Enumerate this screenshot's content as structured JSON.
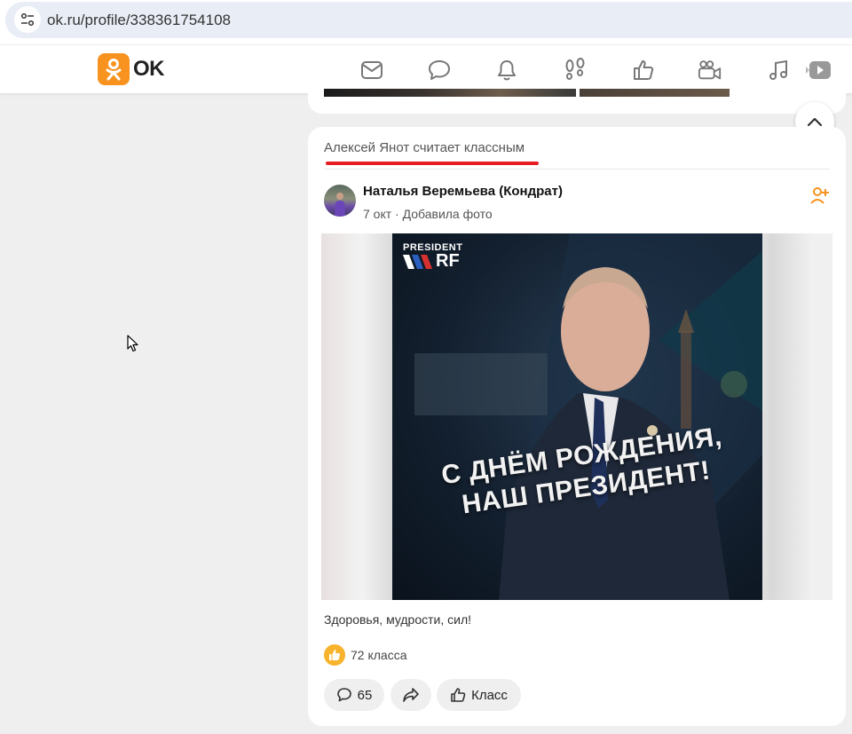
{
  "browser": {
    "url": "ok.ru/profile/338361754108",
    "site_info_icon": "tune-icon"
  },
  "header": {
    "logo_text": "OK",
    "brand_color": "#f7931e",
    "nav_icons": [
      "mail-icon",
      "chat-icon",
      "bell-icon",
      "footprints-icon",
      "thumbs-up-icon",
      "video-icon",
      "music-icon",
      "play-icon"
    ]
  },
  "feed": {
    "card_header": "Алексей Янот считает классным",
    "accent_color": "#e61e24",
    "post": {
      "author": "Наталья Веремьева (Кондрат)",
      "meta": "7 окт · Добавила фото",
      "image": {
        "brand_top": "PRESIDENT",
        "brand_bottom": "RF",
        "headline_line1": "С ДНЁМ РОЖДЕНИЯ,",
        "headline_line2": "НАШ ПРЕЗИДЕНТ!"
      },
      "caption": "Здоровья, мудрости,  сил!",
      "likes_text": "72 класса",
      "comments_count": "65",
      "class_label": "Класс"
    }
  }
}
